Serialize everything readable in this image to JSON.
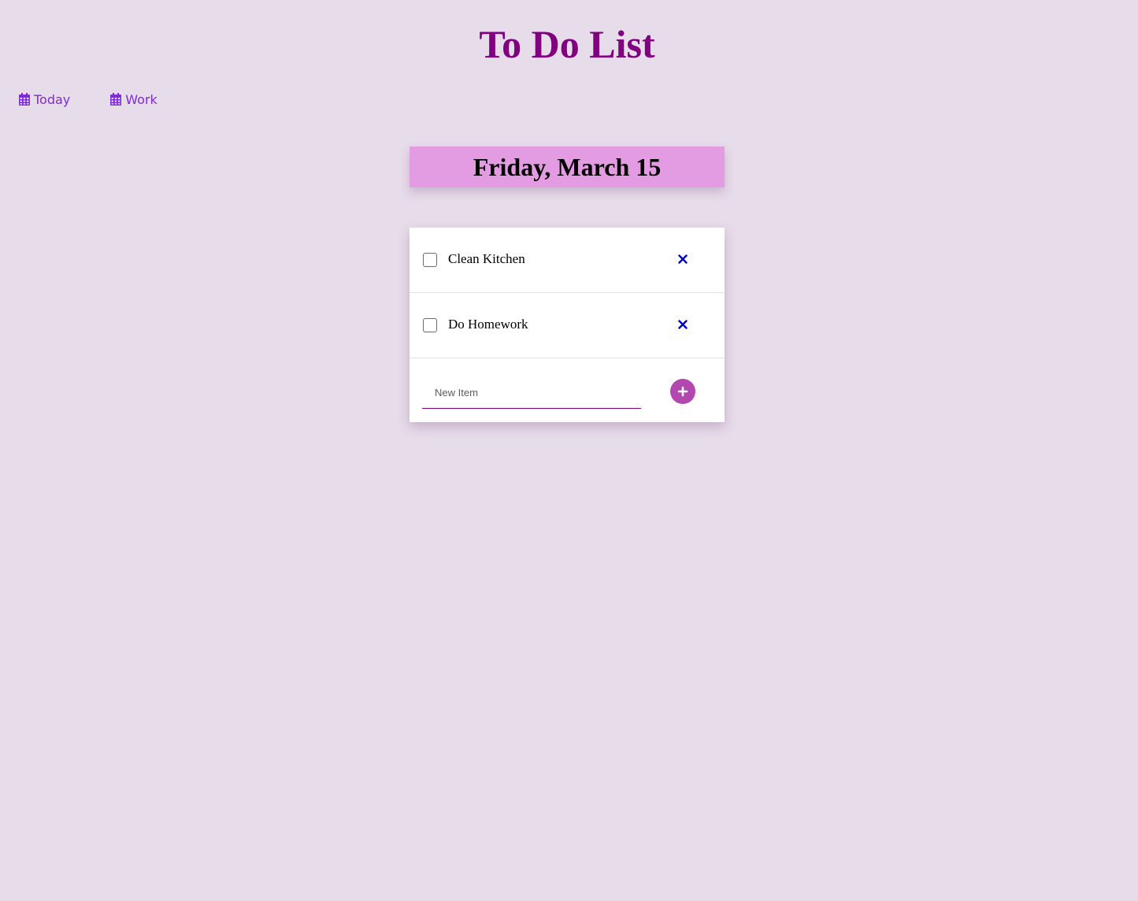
{
  "header": {
    "title": "To Do List"
  },
  "nav": {
    "items": [
      {
        "label": "Today",
        "icon": "calendar-icon"
      },
      {
        "label": "Work",
        "icon": "calendar-icon"
      }
    ]
  },
  "list": {
    "date_title": "Friday, March 15",
    "items": [
      {
        "label": "Clean Kitchen",
        "checked": false
      },
      {
        "label": "Do Homework",
        "checked": false
      }
    ],
    "new_item_placeholder": "New Item",
    "new_item_value": ""
  },
  "colors": {
    "background": "#e7dcea",
    "title": "#800080",
    "nav_link": "#7f2bd8",
    "date_banner": "#e39be1",
    "delete_icon": "#0000cc",
    "add_button": "#b347b0"
  }
}
